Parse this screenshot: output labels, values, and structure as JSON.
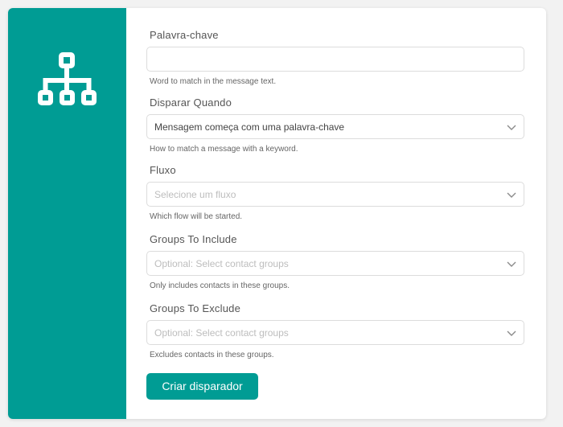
{
  "sidebar": {
    "icon": "flow-hierarchy-icon",
    "color": "#009c94"
  },
  "form": {
    "keyword": {
      "label": "Palavra-chave",
      "value": "",
      "help": "Word to match in the message text."
    },
    "trigger_when": {
      "label": "Disparar Quando",
      "value": "Mensagem começa com uma palavra-chave",
      "help": "How to match a message with a keyword."
    },
    "flow": {
      "label": "Fluxo",
      "placeholder": "Selecione um fluxo",
      "help": "Which flow will be started."
    },
    "groups_include": {
      "label": "Groups To Include",
      "placeholder": "Optional: Select contact groups",
      "help": "Only includes contacts in these groups."
    },
    "groups_exclude": {
      "label": "Groups To Exclude",
      "placeholder": "Optional: Select contact groups",
      "help": "Excludes contacts in these groups."
    },
    "submit_label": "Criar disparador",
    "accent": "#009c94"
  }
}
